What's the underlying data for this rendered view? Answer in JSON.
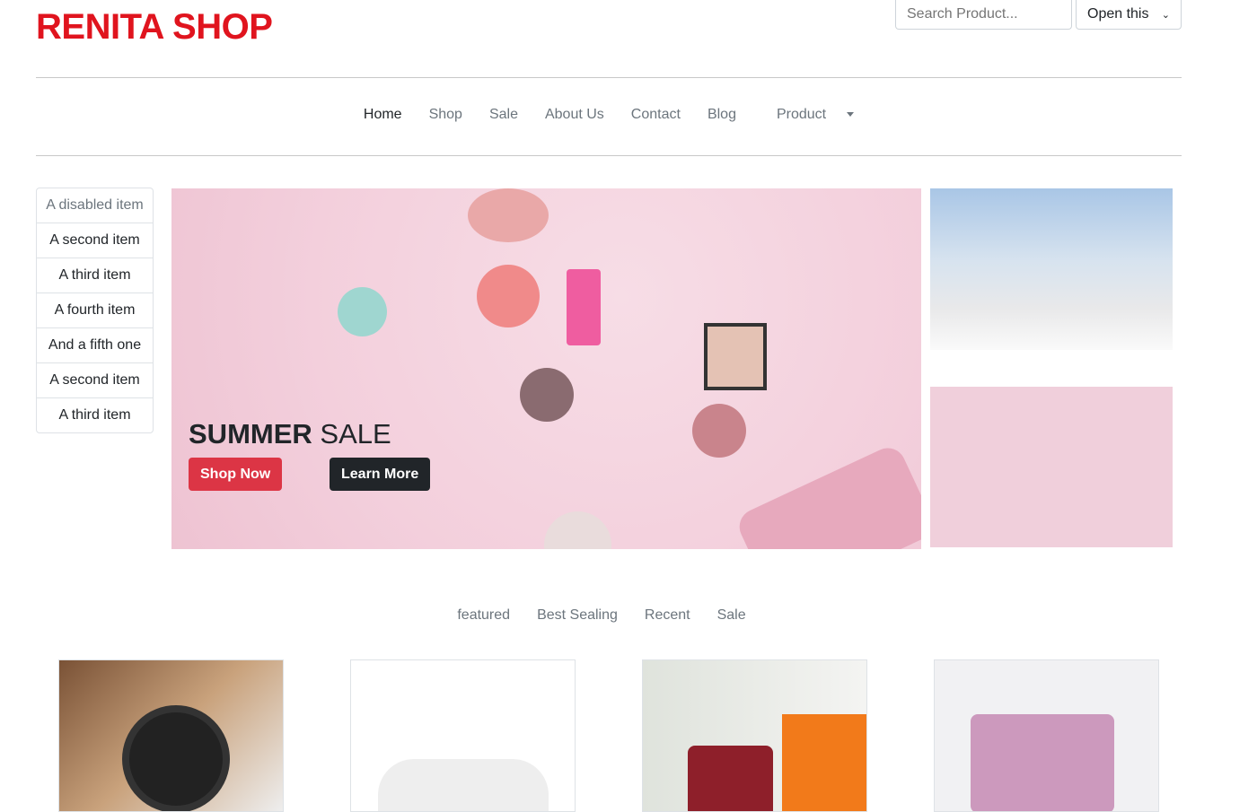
{
  "header": {
    "logo": "RENITA SHOP",
    "search_placeholder": "Search Product...",
    "select_value": "Open this"
  },
  "nav": {
    "items": [
      "Home",
      "Shop",
      "Sale",
      "About Us",
      "Contact",
      "Blog",
      "Product"
    ]
  },
  "sidebar": {
    "items": [
      "A disabled item",
      "A second item",
      "A third item",
      "A fourth item",
      "And a fifth one",
      "A second item",
      "A third item"
    ]
  },
  "hero": {
    "title_bold": "SUMMER",
    "title_rest": "SALE",
    "shop_now": "Shop Now",
    "learn_more": "Learn More",
    "colors": {
      "primary": "#dc3545",
      "dark": "#212529"
    }
  },
  "tabs": [
    "featured",
    "Best Sealing",
    "Recent",
    "Sale"
  ],
  "brand_color": "#e0141e"
}
